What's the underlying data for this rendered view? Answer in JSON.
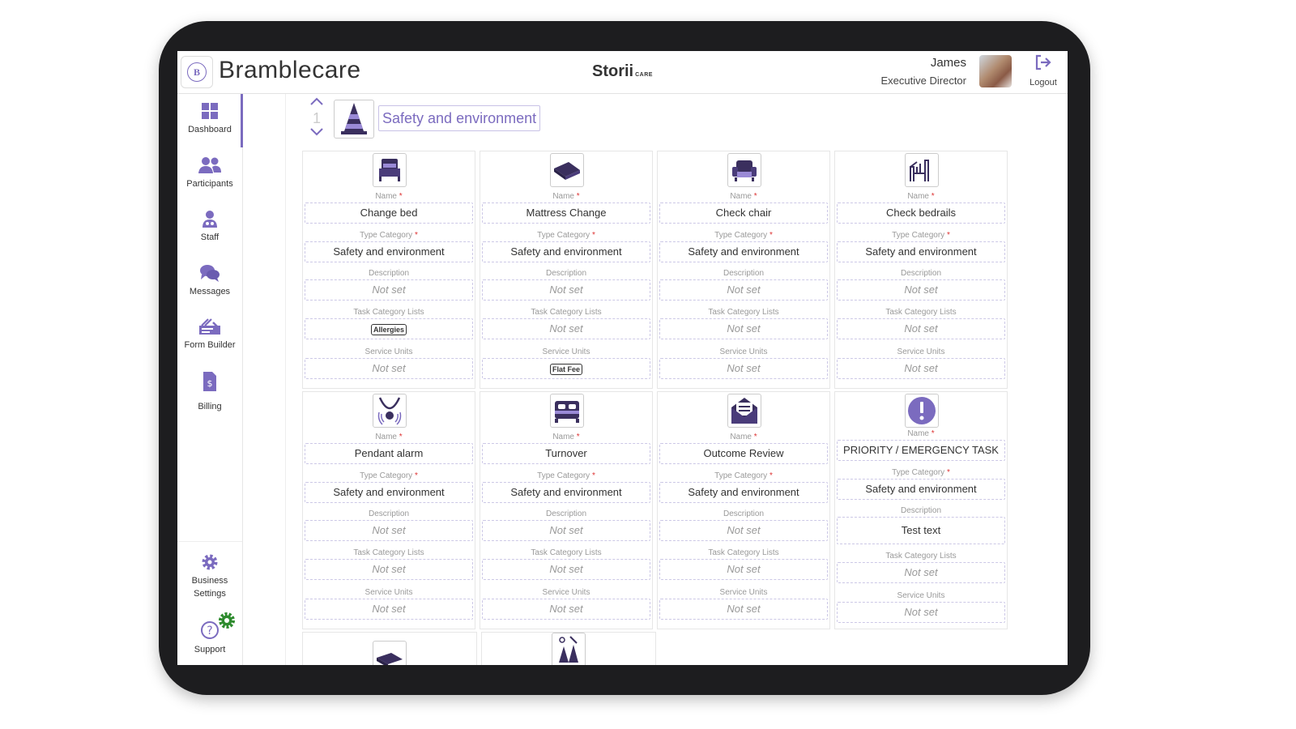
{
  "header": {
    "brand": "Bramblecare",
    "logo_letter": "B",
    "center_logo": "Storii",
    "center_logo_suffix": "CARE",
    "user_name": "James",
    "user_role": "Executive Director",
    "logout_label": "Logout"
  },
  "sidebar": {
    "items": [
      {
        "label": "Dashboard",
        "icon": "dashboard-icon"
      },
      {
        "label": "Participants",
        "icon": "participants-icon"
      },
      {
        "label": "Staff",
        "icon": "staff-icon"
      },
      {
        "label": "Messages",
        "icon": "messages-icon"
      },
      {
        "label": "Form Builder",
        "icon": "form-builder-icon"
      },
      {
        "label": "Billing",
        "icon": "billing-icon"
      }
    ],
    "business_settings_line1": "Business",
    "business_settings_line2": "Settings",
    "support_label": "Support"
  },
  "category": {
    "order_number": "1",
    "title": "Safety and environment"
  },
  "labels": {
    "name": "Name",
    "type_category": "Type Category",
    "description": "Description",
    "task_category_lists": "Task Category Lists",
    "service_units": "Service Units",
    "required_mark": "*"
  },
  "cards": [
    {
      "icon": "bed-icon",
      "name": "Change bed",
      "type_category": "Safety and environment",
      "description": "Not set",
      "task_category_lists": "Allergies",
      "task_category_is_tag": true,
      "service_units": "Not set",
      "service_units_is_tag": false
    },
    {
      "icon": "mattress-icon",
      "name": "Mattress Change",
      "type_category": "Safety and environment",
      "description": "Not set",
      "task_category_lists": "Not set",
      "task_category_is_tag": false,
      "service_units": "Flat Fee",
      "service_units_is_tag": true
    },
    {
      "icon": "armchair-icon",
      "name": "Check chair",
      "type_category": "Safety and environment",
      "description": "Not set",
      "task_category_lists": "Not set",
      "task_category_is_tag": false,
      "service_units": "Not set",
      "service_units_is_tag": false
    },
    {
      "icon": "bedrails-icon",
      "name": "Check bedrails",
      "type_category": "Safety and environment",
      "description": "Not set",
      "task_category_lists": "Not set",
      "task_category_is_tag": false,
      "service_units": "Not set",
      "service_units_is_tag": false
    },
    {
      "icon": "pendant-alarm-icon",
      "name": "Pendant alarm",
      "type_category": "Safety and environment",
      "description": "Not set",
      "task_category_lists": "Not set",
      "task_category_is_tag": false,
      "service_units": "Not set",
      "service_units_is_tag": false
    },
    {
      "icon": "turnover-bed-icon",
      "name": "Turnover",
      "type_category": "Safety and environment",
      "description": "Not set",
      "task_category_lists": "Not set",
      "task_category_is_tag": false,
      "service_units": "Not set",
      "service_units_is_tag": false
    },
    {
      "icon": "envelope-icon",
      "name": "Outcome Review",
      "type_category": "Safety and environment",
      "description": "Not set",
      "task_category_lists": "Not set",
      "task_category_is_tag": false,
      "service_units": "Not set",
      "service_units_is_tag": false
    },
    {
      "icon": "priority-alert-icon",
      "name": "PRIORITY / EMERGENCY TASK",
      "type_category": "Safety and environment",
      "description": "Test text",
      "task_category_lists": "Not set",
      "task_category_is_tag": false,
      "service_units": "Not set",
      "service_units_is_tag": false
    }
  ],
  "colors": {
    "accent": "#7b6bbf",
    "required": "#dd3333",
    "badge_green": "#2e8b2e"
  }
}
